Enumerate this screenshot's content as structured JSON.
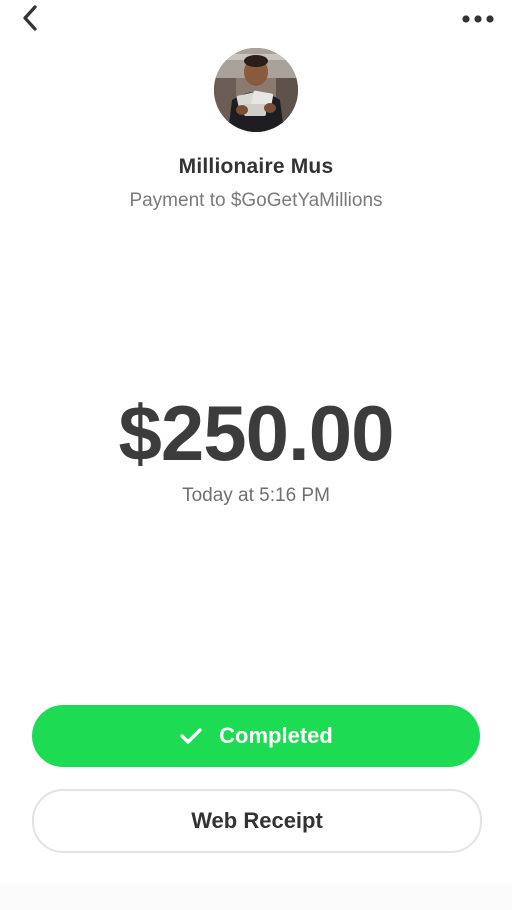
{
  "header": {
    "back_icon": "chevron-left-icon",
    "more_icon": "more-horizontal-icon"
  },
  "recipient": {
    "name": "Millionaire Mus",
    "payment_note": "Payment to $GoGetYaMillions",
    "avatar": "profile-photo"
  },
  "transaction": {
    "amount": "$250.00",
    "timestamp": "Today at 5:16 PM"
  },
  "actions": {
    "status_label": "Completed",
    "status_icon": "check-icon",
    "receipt_label": "Web Receipt"
  },
  "colors": {
    "accent_green": "#1ddb53",
    "text_dark": "#333333",
    "text_muted": "#7a7a7a"
  }
}
